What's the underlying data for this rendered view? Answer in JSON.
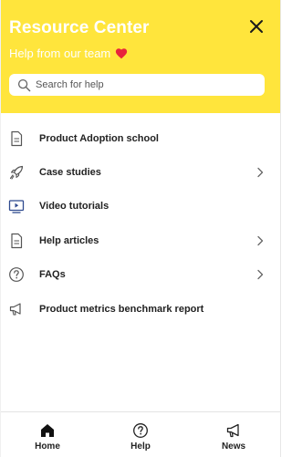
{
  "header": {
    "title": "Resource Center",
    "subtitle": "Help from our team",
    "accent_color": "#ffe53c"
  },
  "search": {
    "placeholder": "Search for help"
  },
  "items": [
    {
      "label": "Product Adoption school",
      "icon": "document-icon",
      "has_chevron": false
    },
    {
      "label": "Case studies",
      "icon": "rocket-icon",
      "has_chevron": true
    },
    {
      "label": "Video tutorials",
      "icon": "video-icon",
      "has_chevron": false
    },
    {
      "label": "Help articles",
      "icon": "document-icon",
      "has_chevron": true
    },
    {
      "label": "FAQs",
      "icon": "question-circle-icon",
      "has_chevron": true
    },
    {
      "label": "Product metrics benchmark report",
      "icon": "megaphone-icon",
      "has_chevron": false
    }
  ],
  "tabs": [
    {
      "label": "Home",
      "icon": "home-icon"
    },
    {
      "label": "Help",
      "icon": "question-circle-icon"
    },
    {
      "label": "News",
      "icon": "megaphone-icon"
    }
  ]
}
